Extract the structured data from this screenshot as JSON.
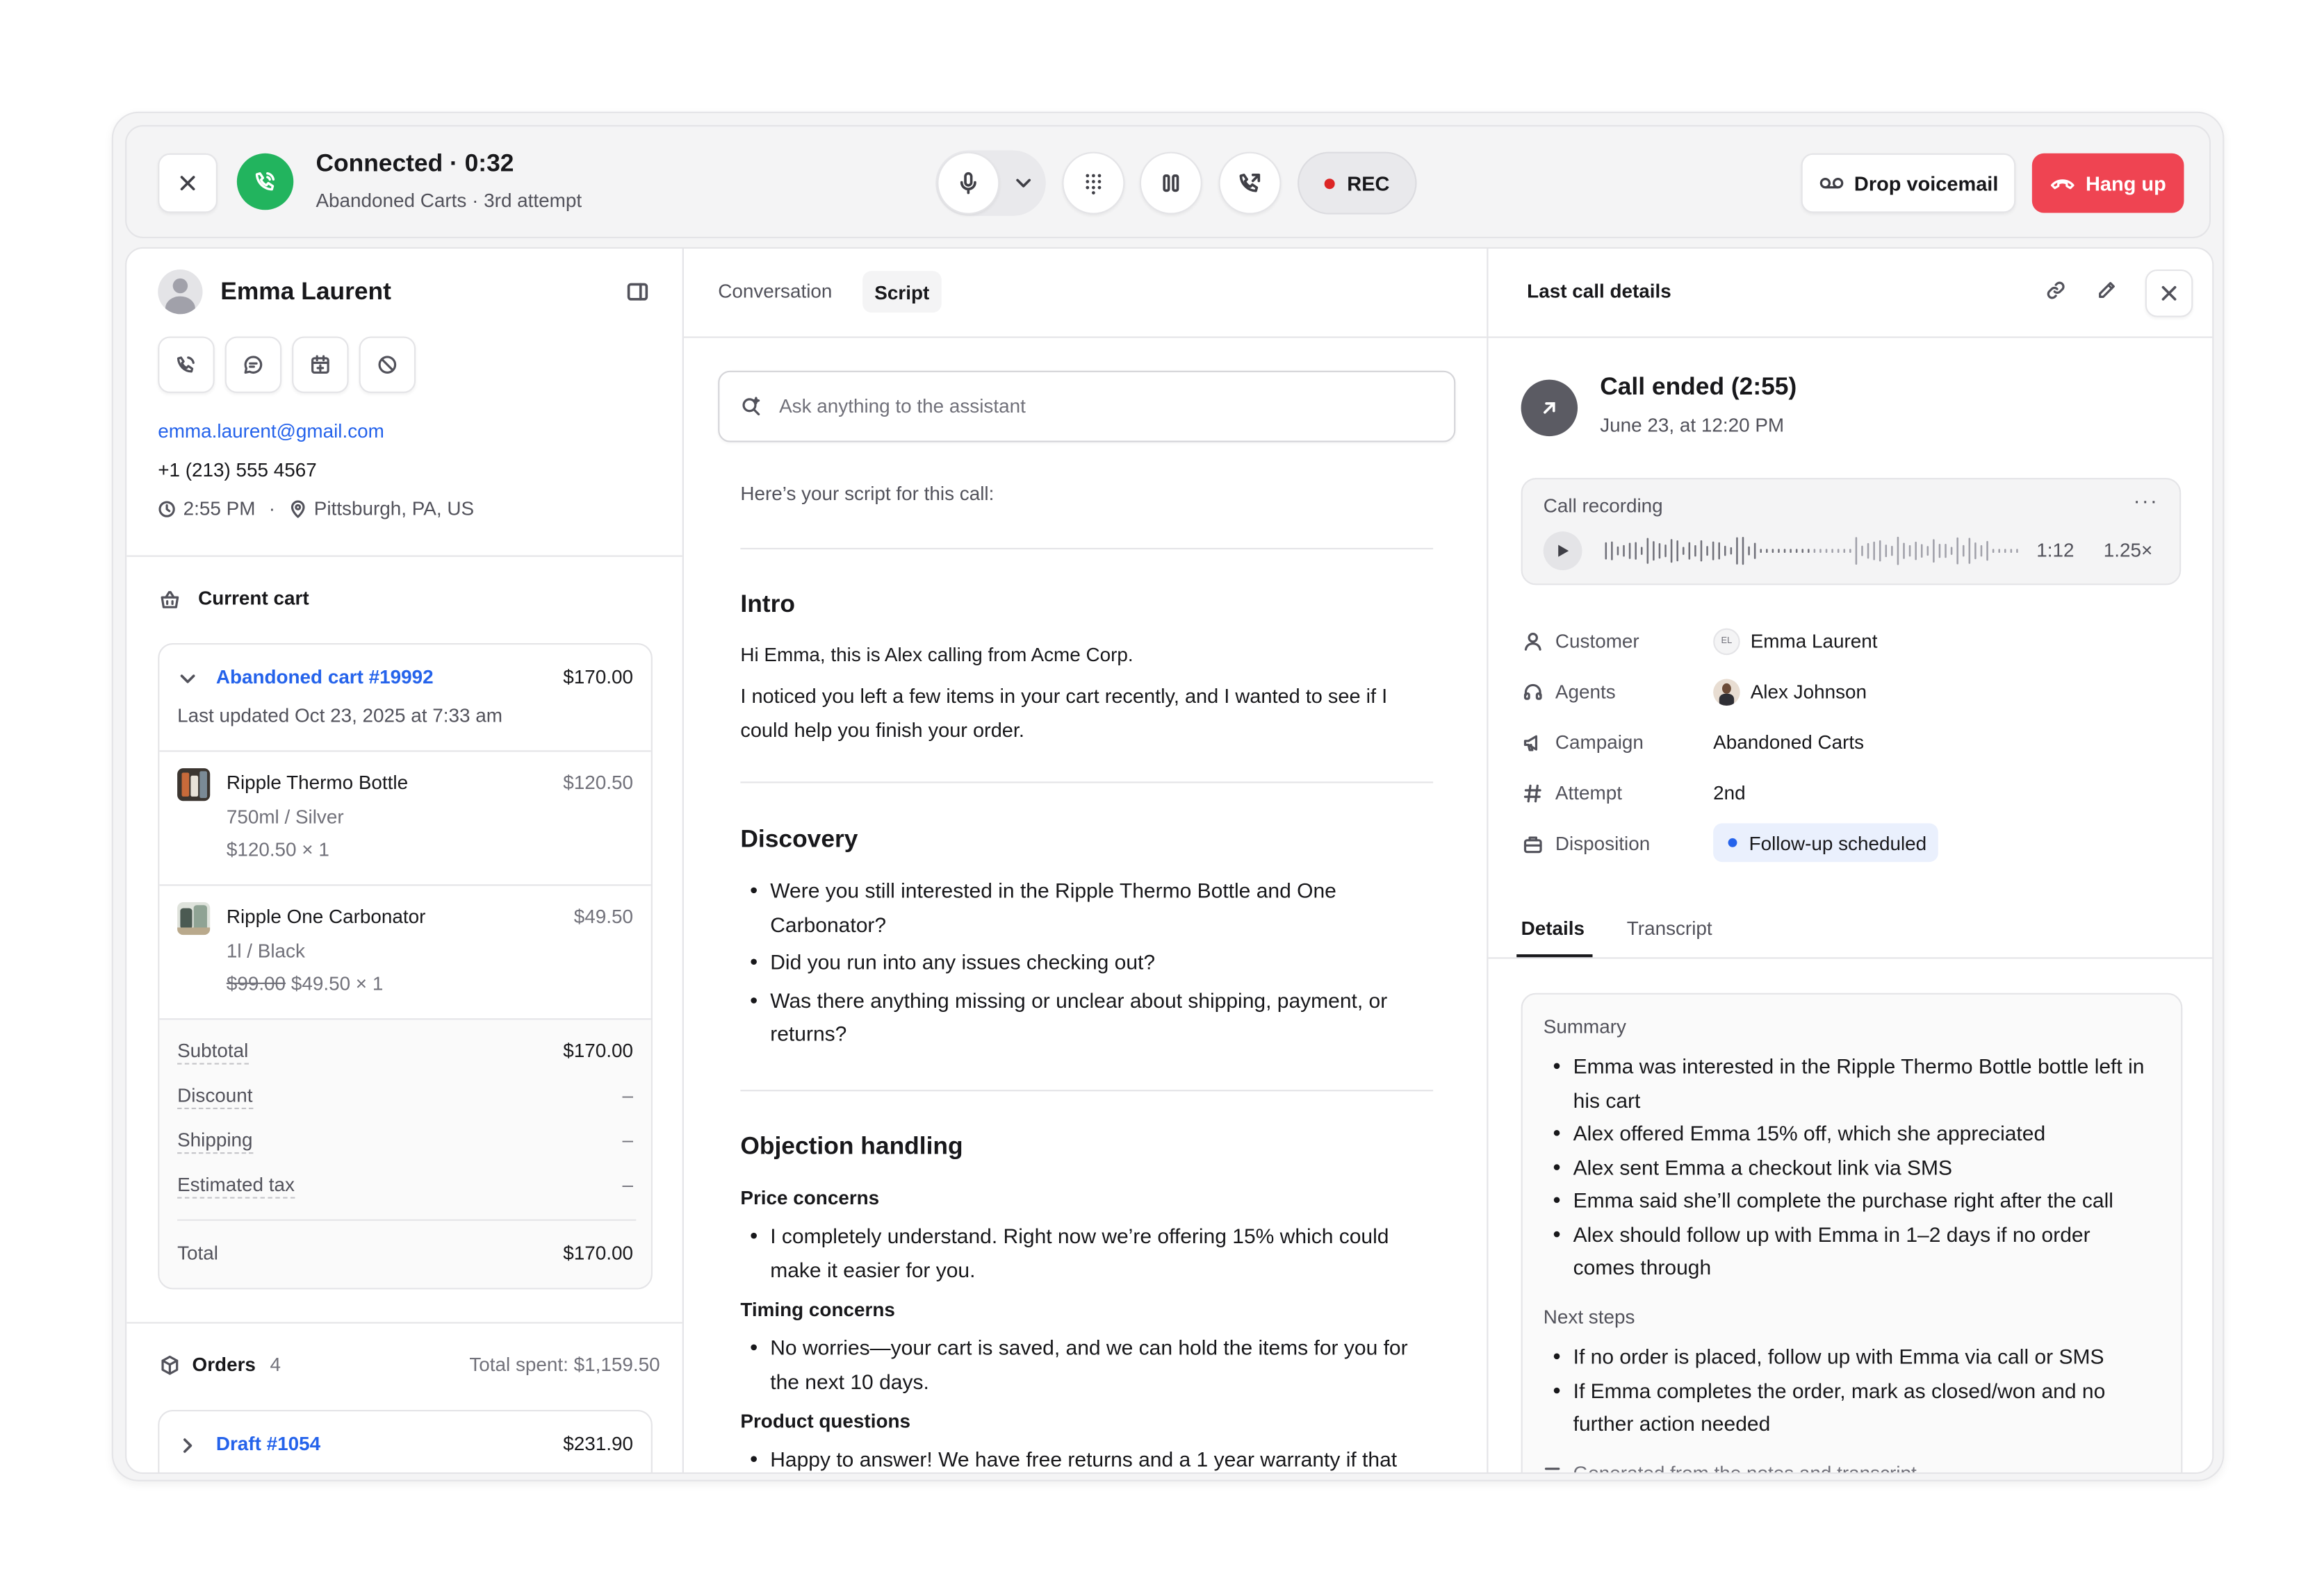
{
  "call_bar": {
    "status": "Connected · 0:32",
    "campaign": "Abandoned Carts",
    "attempt": "3rd attempt",
    "rec_label": "REC",
    "drop_voicemail_label": "Drop voicemail",
    "hang_up_label": "Hang up"
  },
  "contact": {
    "name": "Emma Laurent",
    "email": "emma.laurent@gmail.com",
    "phone": "+1 (213) 555 4567",
    "local_time": "2:55 PM",
    "location": "Pittsburgh, PA, US"
  },
  "cart": {
    "section_title": "Current cart",
    "cart_name": "Abandoned cart #19992",
    "cart_total": "$170.00",
    "last_updated": "Last updated Oct 23, 2025 at 7:33 am",
    "items": [
      {
        "name": "Ripple Thermo Bottle",
        "price": "$120.50",
        "variant": "750ml / Silver",
        "unit_line": "$120.50 × 1",
        "old_price": ""
      },
      {
        "name": "Ripple One Carbonator",
        "price": "$49.50",
        "variant": "1l / Black",
        "unit_line": "$49.50 × 1",
        "old_price": "$99.00"
      }
    ],
    "summary": {
      "subtotal_label": "Subtotal",
      "subtotal_value": "$170.00",
      "discount_label": "Discount",
      "discount_value": "–",
      "shipping_label": "Shipping",
      "shipping_value": "–",
      "tax_label": "Estimated tax",
      "tax_value": "–",
      "total_label": "Total",
      "total_value": "$170.00"
    }
  },
  "orders": {
    "title": "Orders",
    "count": "4",
    "total_spent": "Total spent: $1,159.50",
    "first_order_name": "Draft #1054",
    "first_order_total": "$231.90"
  },
  "middle": {
    "tabs": [
      "Conversation",
      "Script"
    ],
    "active_tab": "Script",
    "assistant_placeholder": "Ask anything to the assistant",
    "script_intro": "Here’s your script for this call:",
    "intro_heading": "Intro",
    "intro_p1": "Hi Emma, this is Alex calling from Acme Corp.",
    "intro_p2": "I noticed you left a few items in your cart recently, and I wanted to see if I could help you finish your order.",
    "discovery_heading": "Discovery",
    "discovery_items": [
      "Were you still interested in the Ripple Thermo Bottle and One Carbonator?",
      "Did you run into any issues checking out?",
      "Was there anything missing or unclear about shipping, payment, or returns?"
    ],
    "objection_heading": "Objection handling",
    "price_heading": "Price concerns",
    "price_item": "I completely understand. Right now we’re offering 15% which could make it easier for you.",
    "timing_heading": "Timing concerns",
    "timing_item": "No worries—your cart is saved, and we can hold the items for you for the next 10 days.",
    "product_heading": "Product questions",
    "product_item": "Happy to answer! We have free returns and a 1 year warranty if that"
  },
  "right": {
    "title": "Last call details",
    "call_ended": "Call ended (2:55)",
    "call_date": "June 23, at 12:20 PM",
    "recording_label": "Call recording",
    "recording_time": "1:12",
    "playback_speed": "1.25×",
    "recording_progress": 0.5,
    "fields": {
      "customer_label": "Customer",
      "customer_initials": "EL",
      "customer_value": "Emma Laurent",
      "agents_label": "Agents",
      "agents_value": "Alex Johnson",
      "campaign_label": "Campaign",
      "campaign_value": "Abandoned Carts",
      "attempt_label": "Attempt",
      "attempt_value": "2nd",
      "disposition_label": "Disposition",
      "disposition_value": "Follow-up scheduled"
    },
    "tabs": [
      "Details",
      "Transcript"
    ],
    "active_tab": "Details",
    "summary_title": "Summary",
    "summary_items": [
      "Emma was interested in the Ripple Thermo Bottle bottle left in his cart",
      "Alex offered Emma 15% off, which she appreciated",
      "Alex sent Emma a checkout link via SMS",
      "Emma said she’ll complete the purchase right after the call",
      "Alex should follow up with Emma in 1–2 days if no order comes through"
    ],
    "next_steps_title": "Next steps",
    "next_steps_items": [
      "If no order is placed, follow up with Emma via call or SMS",
      "If Emma completes the order, mark as closed/won and no further action needed"
    ],
    "generated_note": "Generated from the notes and transcript"
  },
  "colors": {
    "accent_green": "#22b45e",
    "hang_up_red": "#ef4452",
    "link_blue": "#2563eb",
    "rec_dot": "#dc2626",
    "disposition_bg": "#eaf0fd"
  }
}
